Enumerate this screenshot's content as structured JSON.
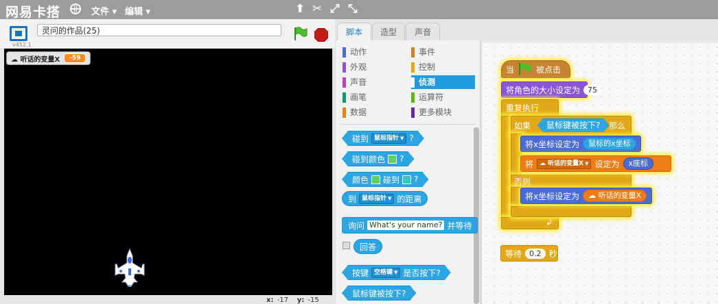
{
  "menubar": {
    "logo": "网易卡搭",
    "file_menu": "文件 ▾",
    "edit_menu": "编辑 ▾",
    "tool_icons": [
      "stamp-icon",
      "cut-icon",
      "grow-icon",
      "shrink-icon"
    ]
  },
  "stage": {
    "version": "v452.1",
    "project_title": "灵问的作品(25)",
    "monitor": {
      "label": "☁ 听话的变量X",
      "value": "-59"
    },
    "coords": {
      "x_label": "x:",
      "x_value": "-17",
      "y_label": "y:",
      "y_value": "-15"
    }
  },
  "tabs": [
    {
      "label": "脚本",
      "active": true
    },
    {
      "label": "造型",
      "active": false
    },
    {
      "label": "声音",
      "active": false
    }
  ],
  "categories": [
    {
      "label": "动作",
      "color": "#4a6cd4"
    },
    {
      "label": "事件",
      "color": "#c88330"
    },
    {
      "label": "外观",
      "color": "#8a55d7"
    },
    {
      "label": "控制",
      "color": "#e1a91a"
    },
    {
      "label": "声音",
      "color": "#bb42c3"
    },
    {
      "label": "侦测",
      "color": "#2ca5e2",
      "selected": true
    },
    {
      "label": "画笔",
      "color": "#0e9a6c"
    },
    {
      "label": "运算符",
      "color": "#5cb712"
    },
    {
      "label": "数据",
      "color": "#ee7d16"
    },
    {
      "label": "更多模块",
      "color": "#632d99"
    }
  ],
  "palette_blocks": {
    "touching": {
      "label": "碰到",
      "dropdown": "鼠标指针",
      "q": "?"
    },
    "touching_color": {
      "label": "碰到颜色",
      "q": "?"
    },
    "color_touching": {
      "label1": "颜色",
      "label2": "碰到",
      "q": "?"
    },
    "distance": {
      "label1": "到",
      "dropdown": "鼠标指针",
      "label2": "的距离"
    },
    "ask": {
      "label1": "询问",
      "input": "What's your name?",
      "label2": "并等待"
    },
    "answer": {
      "label": "回答"
    },
    "key_pressed": {
      "label1": "按键",
      "dropdown": "空格键",
      "label2": "是否按下?"
    },
    "mouse_down": {
      "label": "鼠标键被按下?"
    }
  },
  "script": {
    "hat": {
      "label1": "当",
      "label2": "被点击"
    },
    "set_size": {
      "label": "将角色的大小设定为",
      "value": "75"
    },
    "forever": {
      "label": "重复执行"
    },
    "if_block": {
      "label1": "如果",
      "condition": "鼠标键被按下?",
      "label2": "那么"
    },
    "set_x_mouse": {
      "label": "将x坐标设定为",
      "reporter": "鼠标的x坐标"
    },
    "set_var": {
      "label1": "将",
      "var": "☁ 听话的变量X",
      "label2": "设定为",
      "reporter": "x座标"
    },
    "else_label": "否则",
    "set_x_var": {
      "label": "将x坐标设定为",
      "reporter": "☁ 听话的变量X"
    },
    "wait": {
      "label1": "等待",
      "value": "0.2",
      "label2": "秒"
    }
  }
}
